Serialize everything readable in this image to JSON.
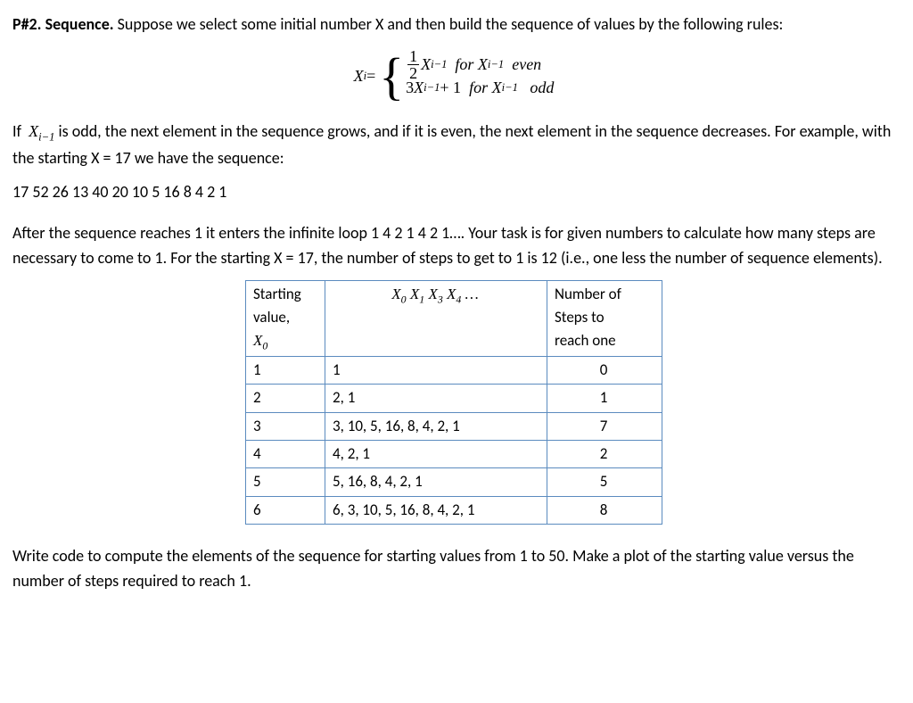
{
  "header": {
    "pnum": "P#2.",
    "title": "Sequence.",
    "intro": "Suppose we select some initial number X and then build the sequence of values by the following rules:"
  },
  "equation": {
    "lhs_var": "X",
    "lhs_sub": "i",
    "eq": " = ",
    "case1_frac_num": "1",
    "case1_frac_den": "2",
    "case1_var": "X",
    "case1_sub": "i−1",
    "case1_for": "  for ",
    "case1_cond_var": "X",
    "case1_cond_sub": "i−1",
    "case1_cond_word": "  even",
    "case2_coef": "3",
    "case2_var": "X",
    "case2_sub": "i−1",
    "case2_plus": " + 1",
    "case2_for": "  for ",
    "case2_cond_var": "X",
    "case2_cond_sub": "i−1",
    "case2_cond_word": "   odd"
  },
  "para2": {
    "pre": "If  ",
    "var": "X",
    "sub": "i−1",
    "rest": "  is odd, the next element in the sequence grows, and if it is even, the next element in the sequence decreases. For example, with the starting  X = 17 we have the sequence:"
  },
  "seq_example": "17 52 26 13 40 20 10 5 16 8 4 2 1",
  "para3": "After the sequence reaches 1 it enters the infinite loop 1 4 2 1 4 2 1…. Your task is for given numbers to calculate how many steps are necessary to come to 1.  For the starting X = 17, the number of steps to get to 1 is 12 (i.e., one less the number of sequence elements).",
  "table": {
    "h1_line1": "Starting",
    "h1_line2": "value,",
    "h1_math_var": "X",
    "h1_math_sub": "0",
    "h2_x0": "X",
    "h2_s0": "0",
    "h2_x1": " X",
    "h2_s1": "1",
    "h2_x3": " X",
    "h2_s3": "3",
    "h2_x4": " X",
    "h2_s4": "4",
    "h2_dots": " …",
    "h3_line1": "Number of",
    "h3_line2": "Steps to",
    "h3_line3": "reach one",
    "rows": [
      {
        "c1": "1",
        "c2": "1",
        "c3": "0"
      },
      {
        "c1": "2",
        "c2": "2, 1",
        "c3": "1"
      },
      {
        "c1": "3",
        "c2": "3, 10, 5, 16, 8, 4, 2, 1",
        "c3": "7"
      },
      {
        "c1": "4",
        "c2": "4, 2, 1",
        "c3": "2"
      },
      {
        "c1": "5",
        "c2": "5, 16, 8, 4, 2, 1",
        "c3": "5"
      },
      {
        "c1": "6",
        "c2": "6, 3, 10, 5, 16, 8, 4, 2, 1",
        "c3": "8"
      }
    ]
  },
  "para4": "Write code to compute the elements of the sequence for starting values from 1 to 50.  Make a plot of the starting value versus the number of steps required to reach 1."
}
